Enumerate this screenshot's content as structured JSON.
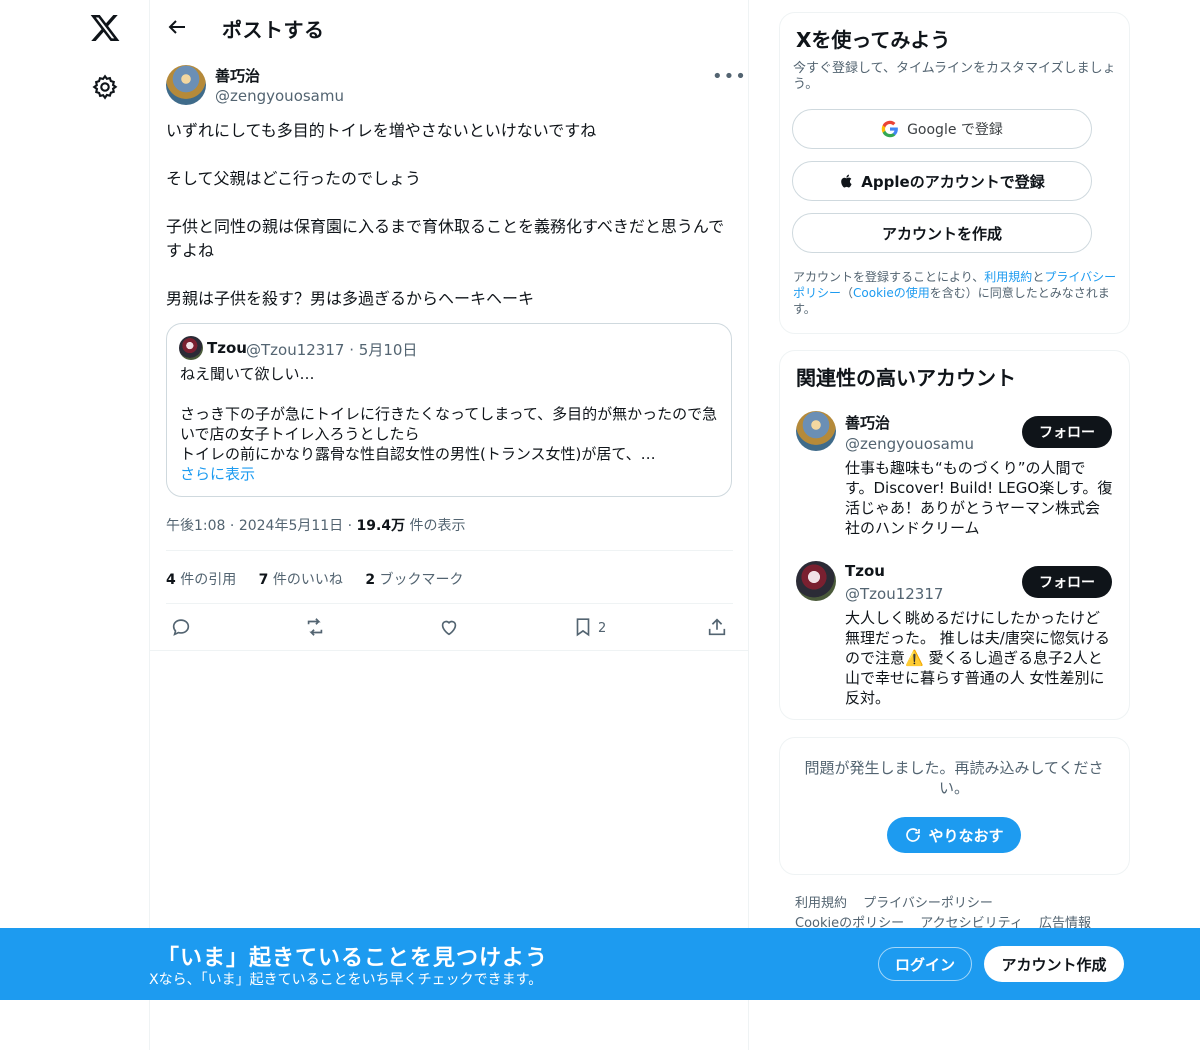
{
  "nav": {
    "logo_icon": "x-logo-icon",
    "settings_icon": "gear-icon"
  },
  "header": {
    "back_icon": "arrow-left-icon",
    "title": "ポストする"
  },
  "post": {
    "author_name": "善巧治",
    "author_handle": "@zengyouosamu",
    "more_icon": "more-horizontal-icon",
    "paragraphs": [
      "いずれにしても多目的トイレを増やさないといけないですね",
      "そして父親はどこ行ったのでしょう",
      "子供と同性の親は保育園に入るまで育休取ることを義務化すべきだと思うんですよね",
      "男親は子供を殺す？男は多過ぎるからヘーキヘーキ"
    ],
    "quote": {
      "name": "Tzou",
      "handle": "@Tzou12317",
      "separator": "·",
      "date": "5月10日",
      "paragraphs": [
        "ねえ聞いて欲しい…",
        "さっき下の子が急にトイレに行きたくなってしまって、多目的が無かったので急いで店の女子トイレ入ろうとしたら\nトイレの前にかなり露骨な性自認女性の男性(トランス女性)が居て、…"
      ],
      "show_more": "さらに表示"
    },
    "time": "午後1:08",
    "date": "2024年5月11日",
    "dot": "·",
    "views_count": "19.4万",
    "views_label": "件の表示",
    "stats": {
      "quotes_count": "4",
      "quotes_label": "件の引用",
      "likes_count": "7",
      "likes_label": "件のいいね",
      "bookmarks_count": "2",
      "bookmarks_label": "ブックマーク"
    },
    "actions": {
      "bookmark_count": "2"
    }
  },
  "signup_card": {
    "title": "Xを使ってみよう",
    "subtitle": "今すぐ登録して、タイムラインをカスタマイズしましょう。",
    "google_label": "Google で登録",
    "apple_label": "Appleのアカウントで登録",
    "create_label": "アカウントを作成",
    "terms_1": "アカウントを登録することにより、",
    "terms_link1": "利用規約",
    "terms_2": "と",
    "terms_link2": "プライバシーポリシー",
    "terms_3": "（",
    "terms_link3": "Cookieの使用",
    "terms_4": "を含む）に同意したとみなされます。"
  },
  "relevant": {
    "title": "関連性の高いアカウント",
    "accounts": [
      {
        "name": "善巧治",
        "handle": "@zengyouosamu",
        "follow_label": "フォロー",
        "bio": "仕事も趣味も“ものづくり”の人間です。Discover! Build! LEGO楽しす。復活じゃあ！ありがとうヤーマン株式会社のハンドクリーム"
      },
      {
        "name": "Tzou",
        "handle": "@Tzou12317",
        "follow_label": "フォロー",
        "bio": "大人しく眺めるだけにしたかったけど無理だった。 推しは夫/唐突に惚気けるので注意⚠️ 愛くるし過ぎる息子2人と山で幸せに暮らす普通の人 女性差別に反対。"
      }
    ]
  },
  "error_card": {
    "message": "問題が発生しました。再読み込みしてください。",
    "retry_label": "やりなおす"
  },
  "footer": {
    "links_row1": [
      "利用規約",
      "プライバシーポリシー"
    ],
    "links_row2": [
      "Cookieのポリシー",
      "アクセシビリティ",
      "広告情報"
    ]
  },
  "banner": {
    "title": "「いま」起きていることを見つけよう",
    "subtitle": "Xなら、「いま」起きていることをいち早くチェックできます。",
    "login_label": "ログイン",
    "signup_label": "アカウント作成"
  },
  "colors": {
    "accent": "#1d9bf0",
    "text": "#0f1419",
    "secondary": "#536471"
  }
}
